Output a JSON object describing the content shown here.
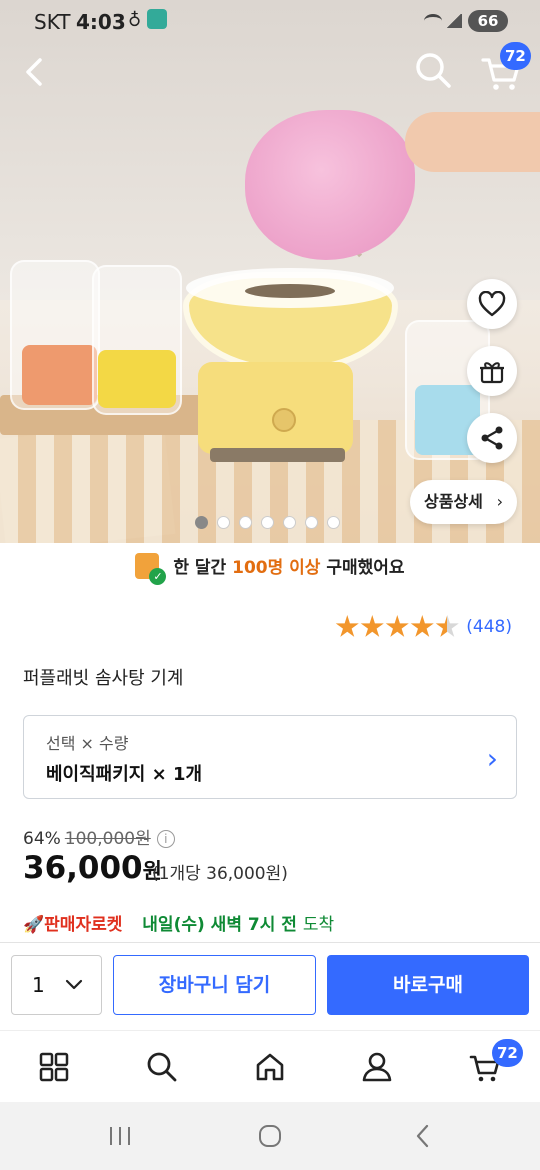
{
  "status_bar": {
    "carrier": "SKT",
    "time": "4:03",
    "battery": "66"
  },
  "header": {
    "cart_badge": "72"
  },
  "hero": {
    "detail_button_label": "상품상세",
    "detail_button_chevron": "›",
    "carousel_total": 7,
    "carousel_active_index": 0
  },
  "promo": {
    "prefix": "한 달간",
    "highlight": "100명 이상",
    "suffix": "구매했어요"
  },
  "rating": {
    "stars": 4.5,
    "count": "(448)"
  },
  "product": {
    "title": "퍼플래빗 솜사탕 기계"
  },
  "option": {
    "label": "선택 × 수량",
    "value": "베이직패키지 × 1개",
    "arrow": "›"
  },
  "pricing": {
    "discount": "64%",
    "original": "100,000원",
    "info_icon": "i",
    "price": "36,000",
    "price_unit": "원",
    "unit_price": "(1개당 36,000원)"
  },
  "delivery": {
    "seller_rocket": "판매자로켓",
    "date": "내일(수) 새벽 7시 전",
    "suffix": "도착"
  },
  "actions": {
    "quantity": "1",
    "add_to_cart": "장바구니 담기",
    "buy_now": "바로구매"
  },
  "bottom_nav": {
    "cart_badge": "72",
    "items": [
      "categories-icon",
      "search-icon",
      "home-icon",
      "user-icon",
      "cart-icon"
    ]
  },
  "colors": {
    "accent": "#346aff",
    "star": "#f2962c",
    "promo_highlight": "#e26d10",
    "delivery_green": "#0f8a35",
    "rocket_red": "#e0301e"
  }
}
